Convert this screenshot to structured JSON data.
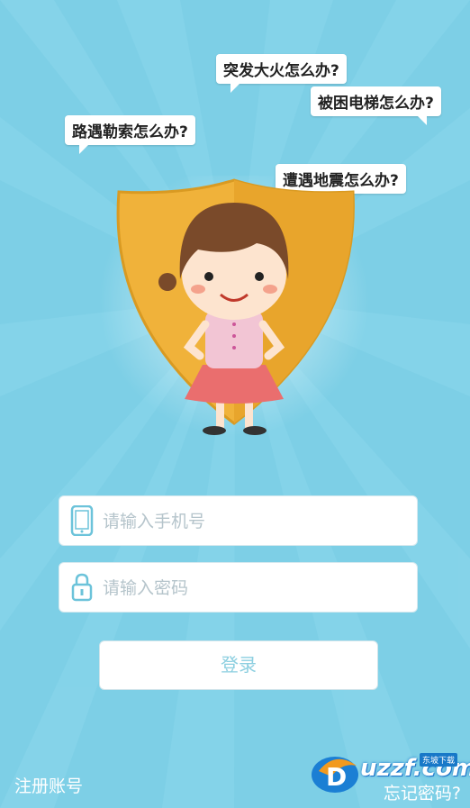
{
  "bubbles": [
    {
      "text": "突发大火怎么办?"
    },
    {
      "text": "被困电梯怎么办?"
    },
    {
      "text": "路遇勒索怎么办?"
    },
    {
      "text": "遭遇地震怎么办?"
    }
  ],
  "login": {
    "phone_placeholder": "请输入手机号",
    "password_placeholder": "请输入密码",
    "submit_label": "登录"
  },
  "footer": {
    "register_label": "注册账号",
    "forgot_label": "忘记密码?"
  },
  "watermark": {
    "text": "uzzf.com",
    "tag": "东坡下载"
  },
  "colors": {
    "background": "#7dcfe6",
    "shield": "#f0b23a",
    "button_text": "#8ccfe0"
  }
}
